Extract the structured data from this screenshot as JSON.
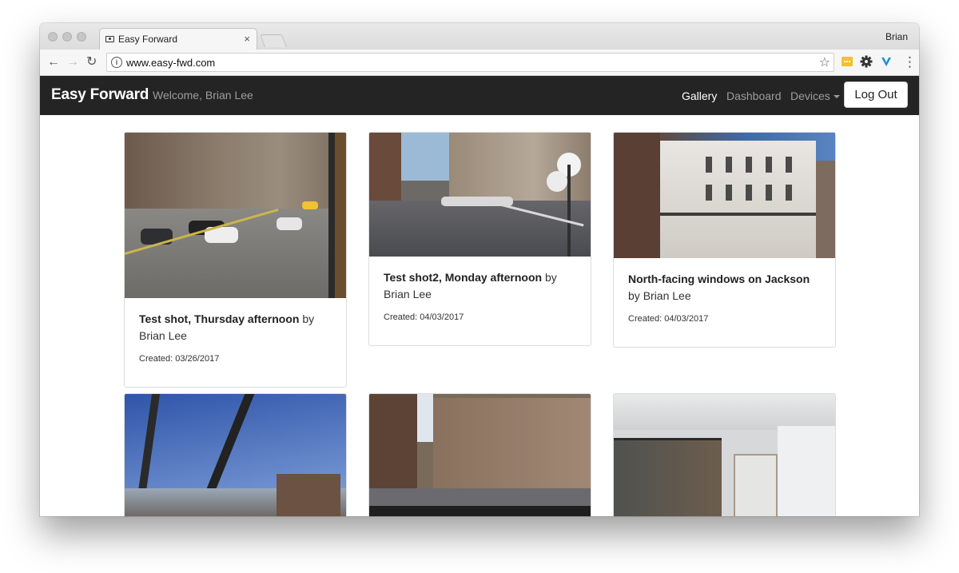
{
  "browser": {
    "tab_title": "Easy Forward",
    "tab_close": "×",
    "profile_name": "Brian",
    "url": "www.easy-fwd.com",
    "back_glyph": "←",
    "forward_glyph": "→",
    "reload_glyph": "↻",
    "star_glyph": "☆",
    "menu_glyph": "⋮",
    "info_glyph": "i"
  },
  "navbar": {
    "brand": "Easy Forward",
    "welcome": "Welcome, Brian Lee",
    "links": {
      "gallery": "Gallery",
      "dashboard": "Dashboard",
      "devices": "Devices"
    },
    "logout": "Log Out"
  },
  "gallery": {
    "by_word": "by",
    "created_prefix": "Created:",
    "cards": [
      {
        "title": "Test shot, Thursday afternoon",
        "author": "Brian Lee",
        "created": "03/26/2017"
      },
      {
        "title": "Test shot2, Monday afternoon",
        "author": "Brian Lee",
        "created": "04/03/2017"
      },
      {
        "title": "North-facing windows on Jackson",
        "author": "Brian Lee",
        "created": "04/03/2017"
      },
      {
        "title": "",
        "author": "",
        "created": ""
      },
      {
        "title": "",
        "author": "",
        "created": ""
      },
      {
        "title": "",
        "author": "",
        "created": ""
      }
    ]
  },
  "colors": {
    "navbar_bg": "#242424",
    "nav_link": "#9d9d9d",
    "nav_active": "#ffffff",
    "card_border": "#dddddd"
  },
  "icons": {
    "extension_1": "sticky-note-icon",
    "extension_2": "gear-icon",
    "extension_3": "v-logo-icon"
  }
}
